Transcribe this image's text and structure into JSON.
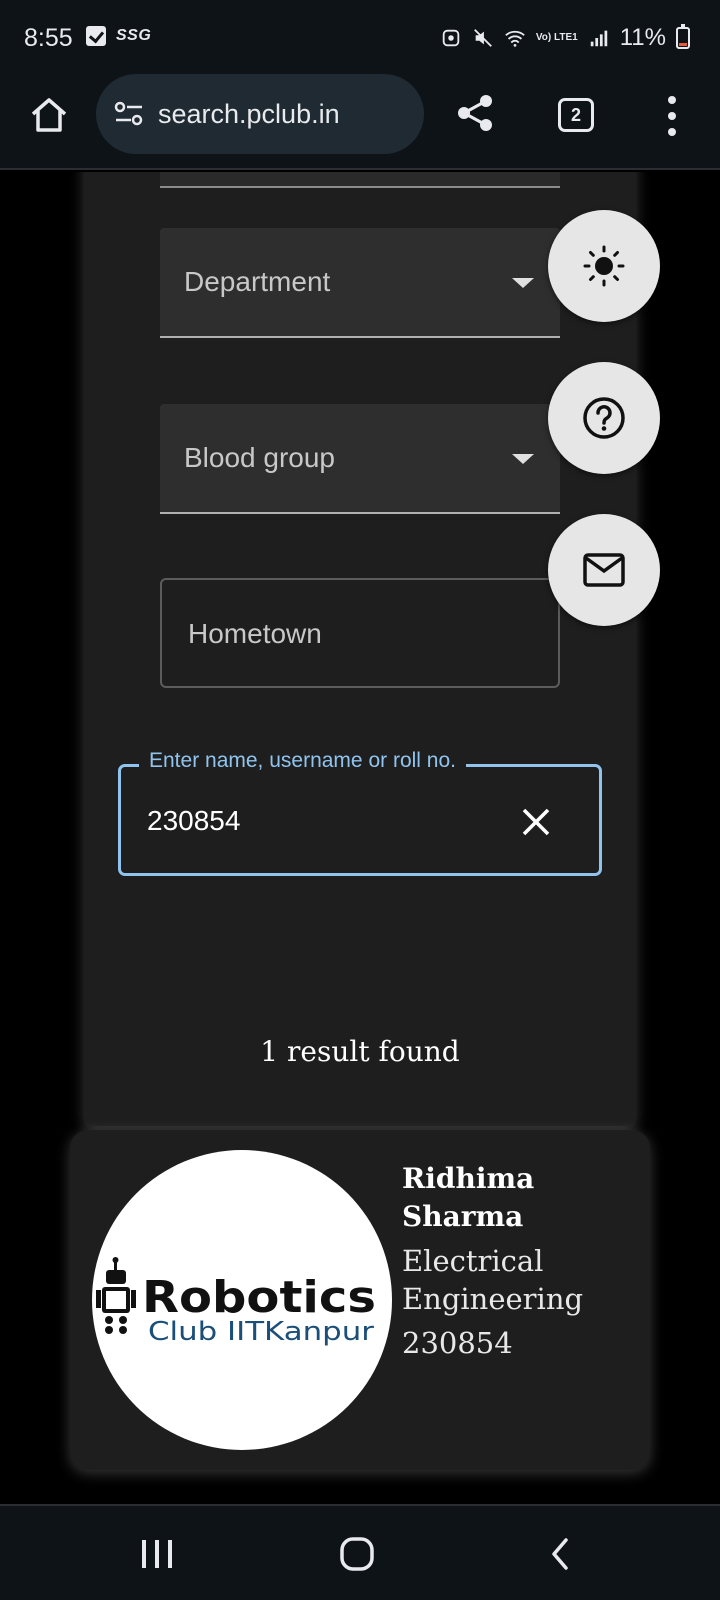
{
  "status_bar": {
    "time": "8:55",
    "carrier_badge": "SSG",
    "network_label": "Vo) LTE1",
    "battery_percent": "11%"
  },
  "browser": {
    "url": "search.pclub.in",
    "tab_count": "2"
  },
  "filters": {
    "department_label": "Department",
    "blood_group_label": "Blood group",
    "hometown_placeholder": "Hometown",
    "search_label": "Enter name, username or roll no.",
    "search_value": "230854"
  },
  "results": {
    "summary": "1 result found",
    "items": [
      {
        "name": "Ridhima Sharma",
        "department": "Electrical Engineering",
        "roll": "230854",
        "avatar_text_1": "Robotics",
        "avatar_text_2": "Club IITKanpur"
      }
    ]
  },
  "colors": {
    "accent": "#90c4ee",
    "card_bg": "#1e1e1e",
    "fab_bg": "#e6e6e6",
    "logo_blue": "#1a4f7a"
  },
  "icons": {
    "fab_theme": "sun-icon",
    "fab_help": "question-circle-icon",
    "fab_mail": "mail-icon"
  }
}
